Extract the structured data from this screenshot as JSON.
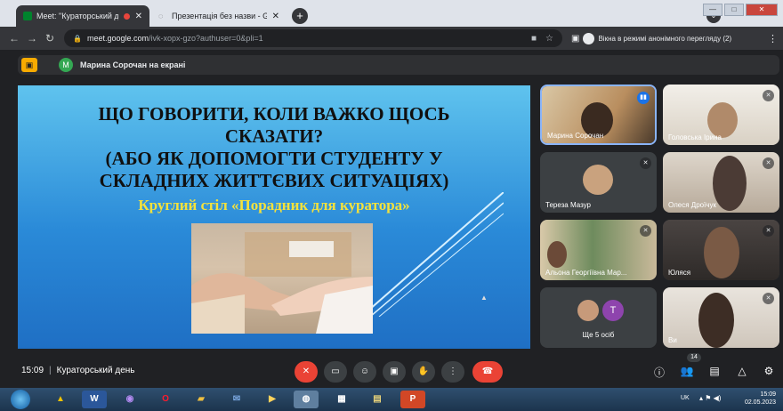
{
  "browser": {
    "tabs": [
      {
        "title": "Meet: \"Кураторський день\"",
        "active": true,
        "recording": true
      },
      {
        "title": "Презентація без назви - Google",
        "active": false
      }
    ],
    "new_tab": "+",
    "profile_badge": "⌄",
    "url_host": "meet.google.com",
    "url_path": "/ivk-xopx-gzo?authuser=0&pli=1",
    "incognito_text": "Вікна в режимі анонімного перегляду (2)"
  },
  "presenter": {
    "avatar_letter": "M",
    "text": "Марина Сорочан на екрані"
  },
  "slide": {
    "title_lines": [
      "ЩО ГОВОРИТИ, КОЛИ ВАЖКО ЩОСЬ",
      "СКАЗАТИ?",
      "(АБО ЯК ДОПОМОГТИ СТУДЕНТУ У",
      "СКЛАДНИХ ЖИТТЄВИХ СИТУАЦІЯХ)"
    ],
    "subtitle": "Круглий стіл «Порадник для куратора»"
  },
  "participants": [
    {
      "name": "Марина Сорочан",
      "speaking": true
    },
    {
      "name": "Головська Ірина"
    },
    {
      "name": "Тереза Мазур"
    },
    {
      "name": "Олеся Дроїчук"
    },
    {
      "name": "Альона Георгіївна Мар..."
    },
    {
      "name": "Юляся"
    },
    {
      "name": "Ще 5 осіб",
      "avatar_letter": "T"
    },
    {
      "name": "Ви"
    }
  ],
  "meeting": {
    "time": "15:09",
    "name": "Кураторський день",
    "participant_count": "14"
  },
  "taskbar": {
    "lang": "UK",
    "clock_time": "15:09",
    "clock_date": "02.05.2023"
  },
  "colors": {
    "meet_bg": "#202124",
    "tile_bg": "#3c4043",
    "accent_blue": "#8ab4f8",
    "hangup_red": "#ea4335",
    "presenter_yellow": "#f9ab00",
    "slide_yellow": "#f4e23c"
  }
}
